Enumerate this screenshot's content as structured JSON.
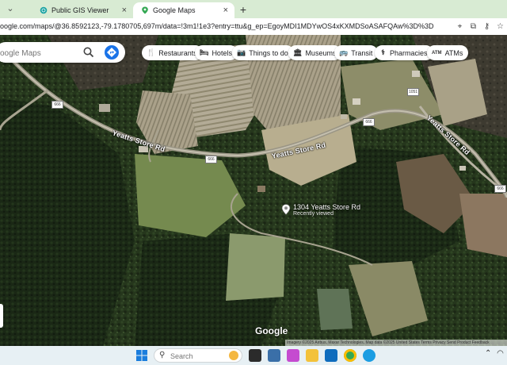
{
  "browser": {
    "tabs": [
      {
        "title": "Public GIS Viewer",
        "active": false
      },
      {
        "title": "Google Maps",
        "active": true
      }
    ],
    "url": "oogle.com/maps/@36.8592123,-79.1780705,697m/data=!3m1!1e3?entry=ttu&g_ep=EgoyMDI1MDYwOS4xKXMDSoASAFQAw%3D%3D"
  },
  "map": {
    "search_placeholder": "oogle Maps",
    "chips": [
      {
        "label": "Restaurants",
        "icon": "fork-knife-icon",
        "glyph": "🍴"
      },
      {
        "label": "Hotels",
        "icon": "bed-icon",
        "glyph": "🛏"
      },
      {
        "label": "Things to do",
        "icon": "camera-icon",
        "glyph": "📷"
      },
      {
        "label": "Museums",
        "icon": "museum-icon",
        "glyph": "🏛"
      },
      {
        "label": "Transit",
        "icon": "bus-icon",
        "glyph": "🚌"
      },
      {
        "label": "Pharmacies",
        "icon": "pharmacy-icon",
        "glyph": "⚕"
      },
      {
        "label": "ATMs",
        "icon": "atm-icon",
        "glyph": "ATM"
      }
    ],
    "roads": [
      {
        "label": "Yeatts Store Rd"
      },
      {
        "label": "Yeatts Store Rd"
      },
      {
        "label": "Yeatts Store Rd"
      }
    ],
    "shields": [
      "666",
      "666",
      "666",
      "1051",
      "666"
    ],
    "place": {
      "title": "1304 Yeatts Store Rd",
      "subtitle": "Recently viewed"
    },
    "logo": "Google",
    "attribution": "Imagery ©2025 Airbus, Maxar Technologies, Map data ©2025   United States   Terms   Privacy   Send Product Feedback"
  },
  "taskbar": {
    "search_placeholder": "Search"
  },
  "colors": {
    "tabbar": "#d8ebd3",
    "directions_blue": "#1a73e8",
    "taskbar": "#e7f0f4"
  }
}
